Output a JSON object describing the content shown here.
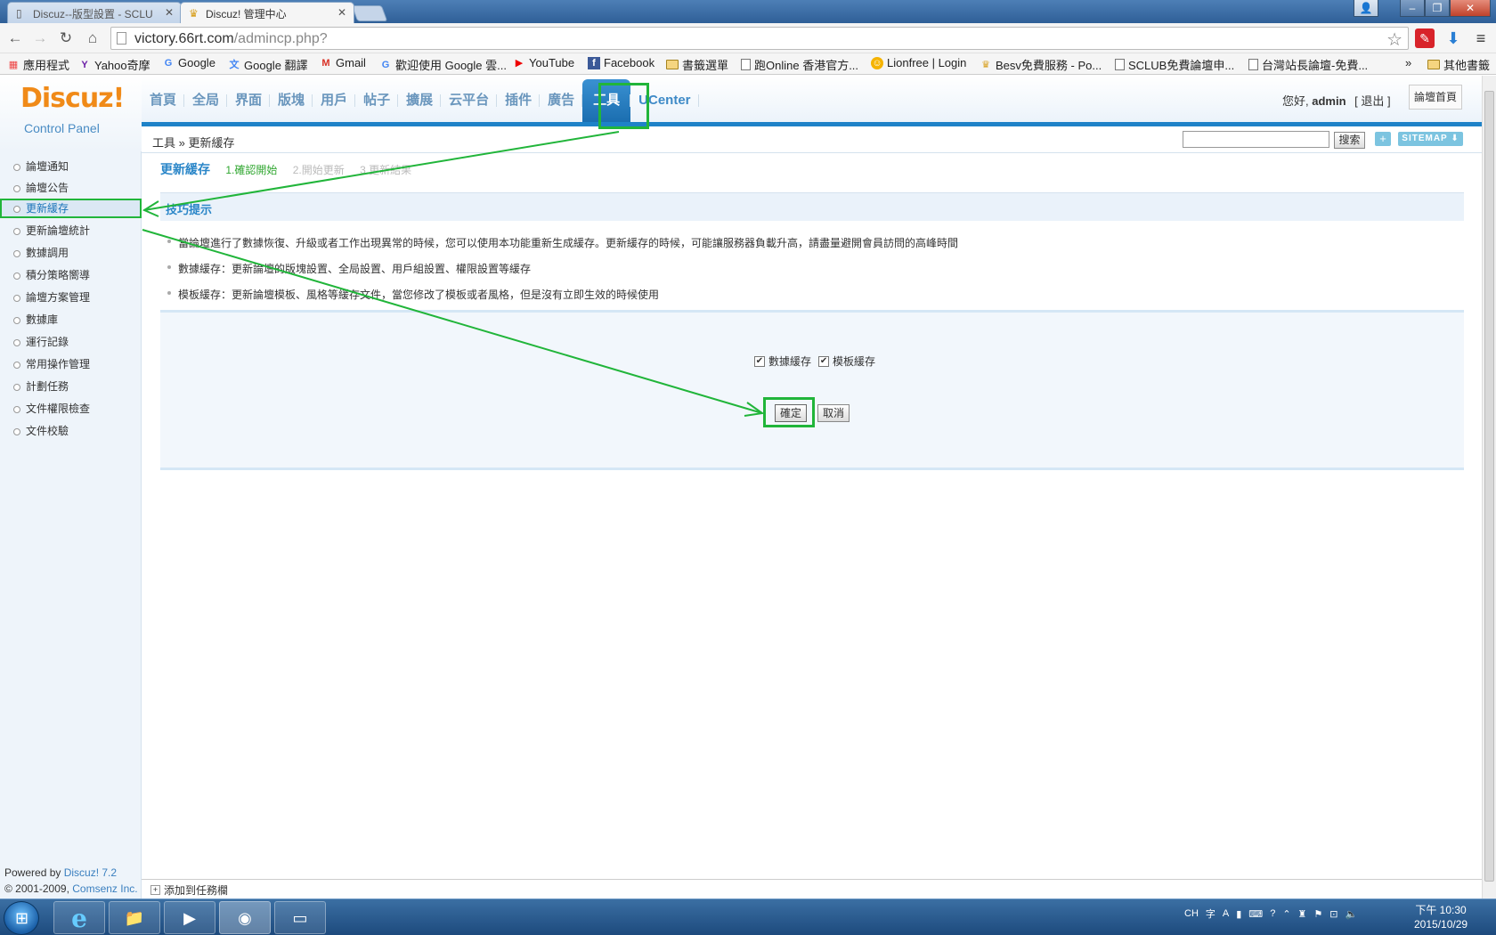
{
  "browser": {
    "tabs": [
      {
        "title": "Discuz--版型設置 - SCLU",
        "active": false
      },
      {
        "title": "Discuz! 管理中心",
        "active": true
      }
    ],
    "url_host": "victory.66rt.com",
    "url_path": "/admincp.php?",
    "bookmarks": [
      "應用程式",
      "Yahoo奇摩",
      "Google",
      "Google 翻譯",
      "Gmail",
      "歡迎使用 Google 雲...",
      "YouTube",
      "Facebook",
      "書籤選單",
      "跑Online 香港官方...",
      "Lionfree | Login",
      "Besv免費服務 - Po...",
      "SCLUB免費論壇申...",
      "台灣站長論壇-免費...",
      "其他書籤"
    ],
    "overflow": "»"
  },
  "header": {
    "logo_main": "Discuz!",
    "logo_sub": "Control Panel",
    "menu": [
      "首頁",
      "全局",
      "界面",
      "版塊",
      "用戶",
      "帖子",
      "擴展",
      "云平台",
      "插件",
      "廣告",
      "工具",
      "UCenter"
    ],
    "active_menu": "工具",
    "greeting_prefix": "您好,",
    "username": "admin",
    "logout": "[ 退出 ]",
    "forum_home": "論壇首頁"
  },
  "breadcrumb": {
    "text": "工具 » 更新緩存"
  },
  "search": {
    "placeholder": "",
    "button": "搜索",
    "plus": "+",
    "sitemap": "SITEMAP ⬇"
  },
  "sidebar": {
    "items": [
      "論壇通知",
      "論壇公告",
      "更新緩存",
      "更新論壇統計",
      "數據調用",
      "積分策略嚮導",
      "論壇方案管理",
      "數據庫",
      "運行記錄",
      "常用操作管理",
      "計劃任務",
      "文件權限檢查",
      "文件校驗"
    ],
    "active": "更新緩存",
    "powered_prefix": "Powered by ",
    "powered_name": "Discuz! 7.2",
    "copyright_prefix": "© 2001-2009, ",
    "copyright_name": "Comsenz Inc."
  },
  "main": {
    "title": "更新緩存",
    "steps": [
      "1.確認開始",
      "2.開始更新",
      "3.更新結果"
    ],
    "tips_title": "技巧提示",
    "tips": [
      "當論壇進行了數據恢復、升級或者工作出現異常的時候，您可以使用本功能重新生成緩存。更新緩存的時候，可能讓服務器負載升高，請盡量避開會員訪問的高峰時間",
      "數據緩存：更新論壇的版塊設置、全局設置、用戶組設置、權限設置等緩存",
      "模板緩存：更新論壇模板、風格等緩存文件，當您修改了模板或者風格，但是沒有立即生效的時候使用"
    ],
    "checkbox_data": "數據緩存",
    "checkbox_template": "模板緩存",
    "data_checked": true,
    "template_checked": true,
    "ok_button": "確定",
    "cancel_button": "取消"
  },
  "statusbar": {
    "add_to_taskbar": "添加到任務欄"
  },
  "taskbar": {
    "tray_lang": "CH",
    "clock_period_time": "下午 10:30",
    "clock_date": "2015/10/29"
  },
  "colors": {
    "highlight": "#21b53a",
    "accent_blue": "#1e82c8",
    "logo_orange": "#f08a18"
  }
}
